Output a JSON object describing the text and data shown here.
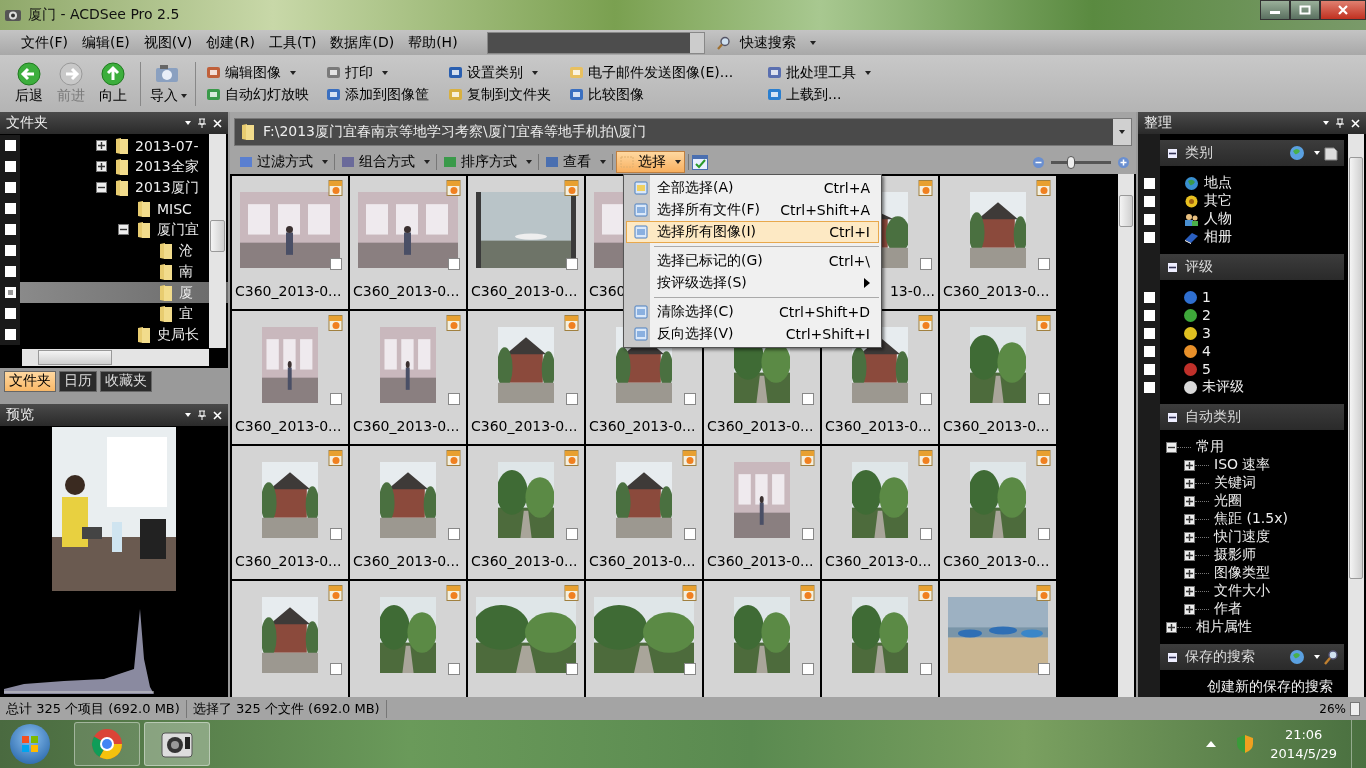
{
  "window": {
    "title": "厦门 - ACDSee Pro 2.5"
  },
  "menu_bar": {
    "menus": [
      "文件(F)",
      "编辑(E)",
      "视图(V)",
      "创建(R)",
      "工具(T)",
      "数据库(D)",
      "帮助(H)"
    ],
    "quick_search": "快速搜索"
  },
  "toolbar": {
    "nav_buttons": [
      {
        "label": "后退",
        "disabled": false,
        "dropdown": false
      },
      {
        "label": "前进",
        "disabled": true,
        "dropdown": false
      },
      {
        "label": "向上",
        "disabled": false,
        "dropdown": false
      },
      {
        "label": "导入",
        "disabled": false,
        "dropdown": true
      }
    ],
    "actions": [
      {
        "label": "编辑图像",
        "dropdown": true
      },
      {
        "label": "自动幻灯放映",
        "dropdown": false
      },
      {
        "label": "打印",
        "dropdown": true
      },
      {
        "label": "添加到图像筐",
        "dropdown": false
      },
      {
        "label": "设置类别",
        "dropdown": true
      },
      {
        "label": "复制到文件夹",
        "dropdown": false
      },
      {
        "label": "电子邮件发送图像(E)...",
        "dropdown": false
      },
      {
        "label": "比较图像",
        "dropdown": false
      },
      {
        "label": "批处理工具",
        "dropdown": true
      },
      {
        "label": "上载到...",
        "dropdown": false
      }
    ]
  },
  "folders_panel": {
    "title": "文件夹",
    "tree": [
      {
        "label": "2013-07-",
        "expanded": false,
        "selected": false,
        "partial": false
      },
      {
        "label": "2013全家",
        "expanded": false,
        "selected": false,
        "partial": false
      },
      {
        "label": "2013厦门",
        "expanded": true,
        "selected": false,
        "partial": false,
        "children": [
          {
            "label": "MISC",
            "selected": false,
            "partial": false
          },
          {
            "label": "厦门宜",
            "expanded": true,
            "selected": false,
            "partial": false,
            "children": [
              {
                "label": "沧",
                "selected": false,
                "partial": false
              },
              {
                "label": "南",
                "selected": false,
                "partial": false
              },
              {
                "label": "厦",
                "selected": true,
                "partial": true
              },
              {
                "label": "宜",
                "selected": false,
                "partial": false
              }
            ]
          },
          {
            "label": "史局长",
            "selected": false,
            "partial": false
          }
        ]
      }
    ],
    "tabs": [
      {
        "label": "文件夹",
        "selected": true
      },
      {
        "label": "日历",
        "selected": false
      },
      {
        "label": "收藏夹",
        "selected": false
      }
    ]
  },
  "preview_panel": {
    "title": "预览"
  },
  "browser": {
    "path": "F:\\2013厦门宜春南京等地学习考察\\厦门宜春等地手机拍\\厦门",
    "tools": [
      {
        "label": "过滤方式",
        "selected": false
      },
      {
        "label": "组合方式",
        "selected": false
      },
      {
        "label": "排序方式",
        "selected": false
      },
      {
        "label": "查看",
        "selected": false
      },
      {
        "label": "选择",
        "selected": true
      }
    ],
    "zoom": {
      "level": 0.33
    },
    "thumbnails": [
      {
        "caption": "C360_2013-0...",
        "picture": true,
        "badge": true,
        "checkbox": {
          "checked": false
        },
        "caption_clipped": false
      },
      {
        "caption": "C360_2013-0...",
        "picture": true,
        "badge": true,
        "checkbox": {
          "checked": false
        },
        "caption_clipped": false
      },
      {
        "caption": "C360_2013-0...",
        "picture": true,
        "badge": true,
        "checkbox": {
          "checked": false
        },
        "caption_clipped": false
      },
      {
        "caption": "C360",
        "picture": true,
        "badge": false,
        "caption_clipped": false
      },
      {
        "caption": "13-0...",
        "picture": true,
        "badge": true,
        "checkbox": {
          "checked": false
        },
        "caption_clipped": true,
        "after_covered_slot": true
      },
      {
        "caption": "C360_2013-0...",
        "picture": true,
        "badge": true,
        "checkbox": {
          "checked": false
        },
        "caption_clipped": false
      },
      {
        "caption": "C360_2013-0...",
        "picture": true,
        "badge": true,
        "checkbox": {
          "checked": false
        },
        "caption_clipped": false
      },
      {
        "caption": "C360_2013-0...",
        "picture": true,
        "badge": true,
        "checkbox": {
          "checked": false
        },
        "caption_clipped": false
      },
      {
        "caption": "C360_2013-0...",
        "picture": true,
        "badge": true,
        "checkbox": {
          "checked": false
        },
        "caption_clipped": false
      },
      {
        "caption": "C360_2013-0...",
        "picture": true,
        "badge": false,
        "checkbox": {
          "checked": false
        },
        "caption_clipped": false
      },
      {
        "caption": "C360_2013-0...",
        "picture": true,
        "badge": false,
        "checkbox": {
          "checked": false
        },
        "caption_clipped": false
      },
      {
        "caption": "C360_2013-0...",
        "picture": true,
        "badge": true,
        "checkbox": {
          "checked": false
        },
        "caption_clipped": false
      },
      {
        "caption": "C360_2013-0...",
        "picture": true,
        "badge": true,
        "checkbox": {
          "checked": false
        },
        "caption_clipped": false
      },
      {
        "caption": "C360_2013-0...",
        "picture": true,
        "badge": true,
        "checkbox": {
          "checked": false
        },
        "caption_clipped": false
      },
      {
        "caption": "C360_2013-0...",
        "picture": true,
        "badge": true,
        "checkbox": {
          "checked": false
        },
        "caption_clipped": false
      },
      {
        "caption": "C360_2013-0...",
        "picture": true,
        "badge": true,
        "checkbox": {
          "checked": false
        },
        "caption_clipped": false
      },
      {
        "caption": "C360_2013-0...",
        "picture": true,
        "badge": true,
        "checkbox": {
          "checked": false
        },
        "caption_clipped": false
      },
      {
        "caption": "C360_2013-0...",
        "picture": true,
        "badge": true,
        "checkbox": {
          "checked": false
        },
        "caption_clipped": false
      },
      {
        "caption": "C360_2013-0...",
        "picture": true,
        "badge": true,
        "checkbox": {
          "checked": false
        },
        "caption_clipped": false
      },
      {
        "caption": "C360_2013-0...",
        "picture": true,
        "badge": true,
        "checkbox": {
          "checked": false
        },
        "caption_clipped": false
      },
      {
        "picture": true,
        "badge": true,
        "checkbox": {
          "checked": false
        }
      },
      {
        "picture": true,
        "badge": true,
        "checkbox": {
          "checked": false
        }
      },
      {
        "picture": true,
        "badge": true,
        "checkbox": {
          "checked": false
        }
      },
      {
        "picture": true,
        "badge": true,
        "checkbox": {
          "checked": false
        }
      },
      {
        "picture": true,
        "badge": true,
        "checkbox": {
          "checked": false
        }
      },
      {
        "picture": true,
        "badge": true,
        "checkbox": {
          "checked": false
        }
      },
      {
        "picture": true,
        "badge": true,
        "checkbox": {
          "checked": false
        }
      }
    ],
    "select_menu": [
      {
        "kind": "icon",
        "label": "全部选择(A)",
        "shortcut": "Ctrl+A",
        "selected": false
      },
      {
        "kind": "icon",
        "label": "选择所有文件(F)",
        "shortcut": "Ctrl+Shift+A",
        "selected": false
      },
      {
        "kind": "icon",
        "label": "选择所有图像(I)",
        "shortcut": "Ctrl+I",
        "selected": true
      },
      {
        "kind": "separator"
      },
      {
        "kind": "plain",
        "label": "选择已标记的(G)",
        "shortcut": "Ctrl+\\",
        "selected": false
      },
      {
        "kind": "submenu",
        "label": "按评级选择(S)",
        "selected": false
      },
      {
        "kind": "separator"
      },
      {
        "kind": "icon",
        "label": "清除选择(C)",
        "shortcut": "Ctrl+Shift+D",
        "selected": false
      },
      {
        "kind": "icon",
        "label": "反向选择(V)",
        "shortcut": "Ctrl+Shift+I",
        "selected": false
      }
    ]
  },
  "organize_panel": {
    "title": "整理",
    "sections": [
      {
        "kind": "categories",
        "title": "类别",
        "expanded": true,
        "items": [
          {
            "label": "地点",
            "checked": false
          },
          {
            "label": "其它",
            "checked": false
          },
          {
            "label": "人物",
            "checked": false
          },
          {
            "label": "相册",
            "checked": false
          }
        ]
      },
      {
        "kind": "ratings",
        "title": "评级",
        "expanded": true,
        "items": [
          {
            "label": "1",
            "color": "#2f6fd0",
            "checked": false
          },
          {
            "label": "2",
            "color": "#3ea83a",
            "checked": false
          },
          {
            "label": "3",
            "color": "#e0c020",
            "checked": false
          },
          {
            "label": "4",
            "color": "#e8902a",
            "checked": false
          },
          {
            "label": "5",
            "color": "#c0302a",
            "checked": false
          },
          {
            "label": "未评级",
            "color": "#d9d9d9",
            "checked": false
          }
        ]
      },
      {
        "kind": "auto",
        "title": "自动类别",
        "expanded": true,
        "tree": [
          {
            "label": "常用",
            "expanded": true,
            "children": [
              {
                "label": "ISO 速率",
                "expanded": false
              },
              {
                "label": "关键词",
                "expanded": false
              },
              {
                "label": "光圈",
                "expanded": false
              },
              {
                "label": "焦距 (1.5x)",
                "expanded": false
              },
              {
                "label": "快门速度",
                "expanded": false
              },
              {
                "label": "摄影师",
                "expanded": false
              },
              {
                "label": "图像类型",
                "expanded": false
              },
              {
                "label": "文件大小",
                "expanded": false
              },
              {
                "label": "作者",
                "expanded": false
              }
            ]
          },
          {
            "label": "相片属性",
            "expanded": false
          }
        ]
      },
      {
        "kind": "saved",
        "title": "保存的搜索",
        "expanded": true,
        "items": [
          {
            "label": "创建新的保存的搜索"
          }
        ]
      }
    ]
  },
  "status_bar": {
    "total": "总计 325 个项目 (692.0 MB)",
    "selected": "选择了 325 个文件 (692.0 MB)",
    "zoom": "26%"
  },
  "taskbar": {
    "time": "21:06",
    "date": "2014/5/29"
  }
}
